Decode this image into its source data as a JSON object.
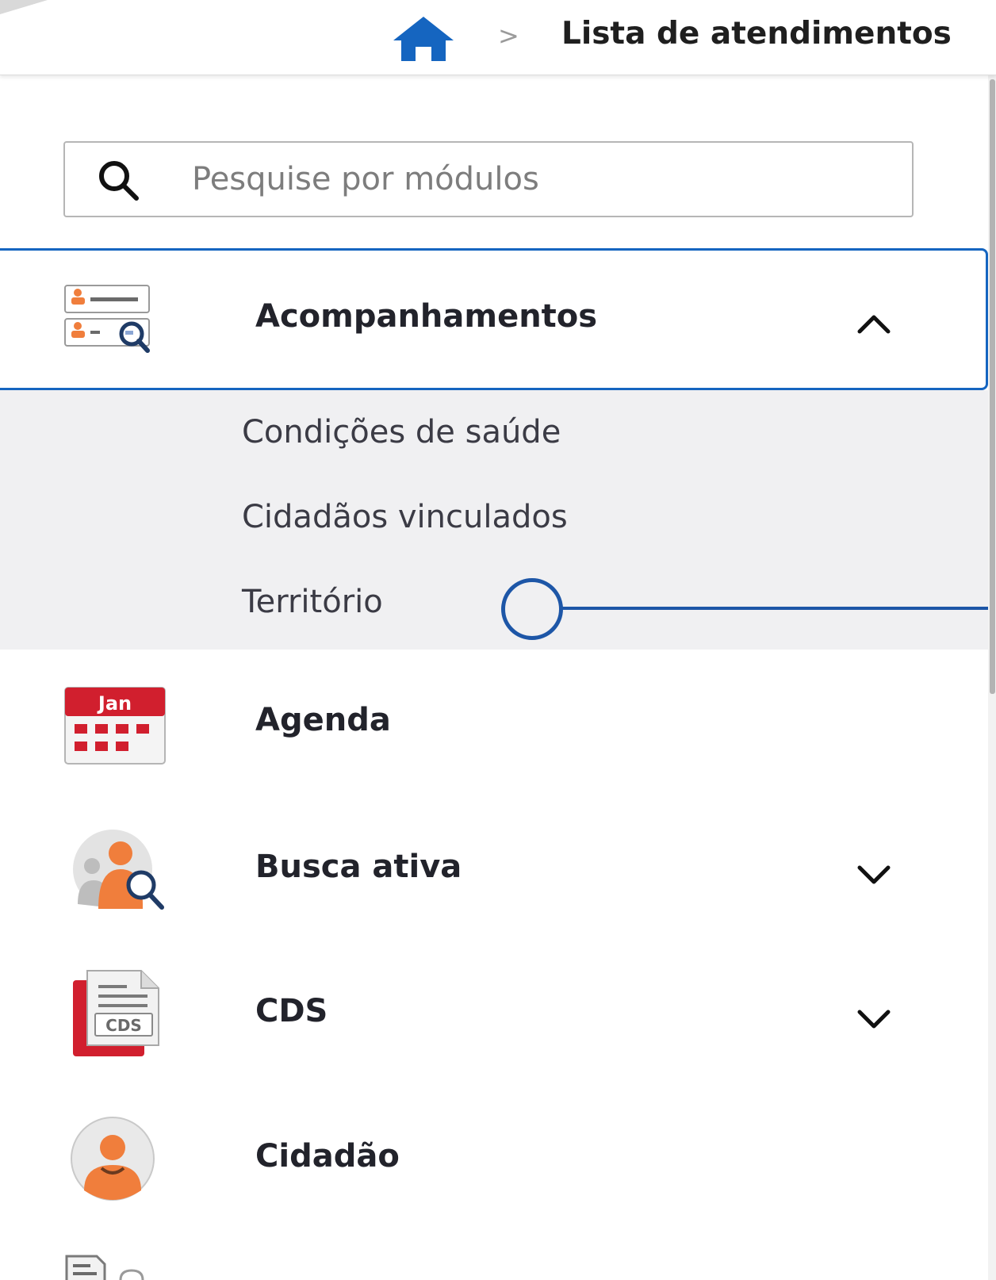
{
  "header": {
    "breadcrumb_separator": ">",
    "current_page": "Lista de atendimentos",
    "home_icon": "home-icon",
    "accent_color": "#1565c0"
  },
  "search": {
    "placeholder": "Pesquise por módulos",
    "value": "",
    "icon": "search-icon"
  },
  "menu": {
    "items": [
      {
        "label": "Acompanhamentos",
        "icon": "acompanhamentos-icon",
        "expanded": true,
        "chevron": "chevron-up-icon",
        "subitems": [
          "Condições de saúde",
          "Cidadãos vinculados",
          "Território"
        ]
      },
      {
        "label": "Agenda",
        "icon": "calendar-icon",
        "calendar_month": "Jan"
      },
      {
        "label": "Busca ativa",
        "icon": "busca-ativa-icon",
        "expanded": false,
        "chevron": "chevron-down-icon"
      },
      {
        "label": "CDS",
        "icon": "cds-document-icon",
        "icon_text": "CDS",
        "expanded": false,
        "chevron": "chevron-down-icon"
      },
      {
        "label": "Cidadão",
        "icon": "citizen-avatar-icon"
      }
    ]
  }
}
